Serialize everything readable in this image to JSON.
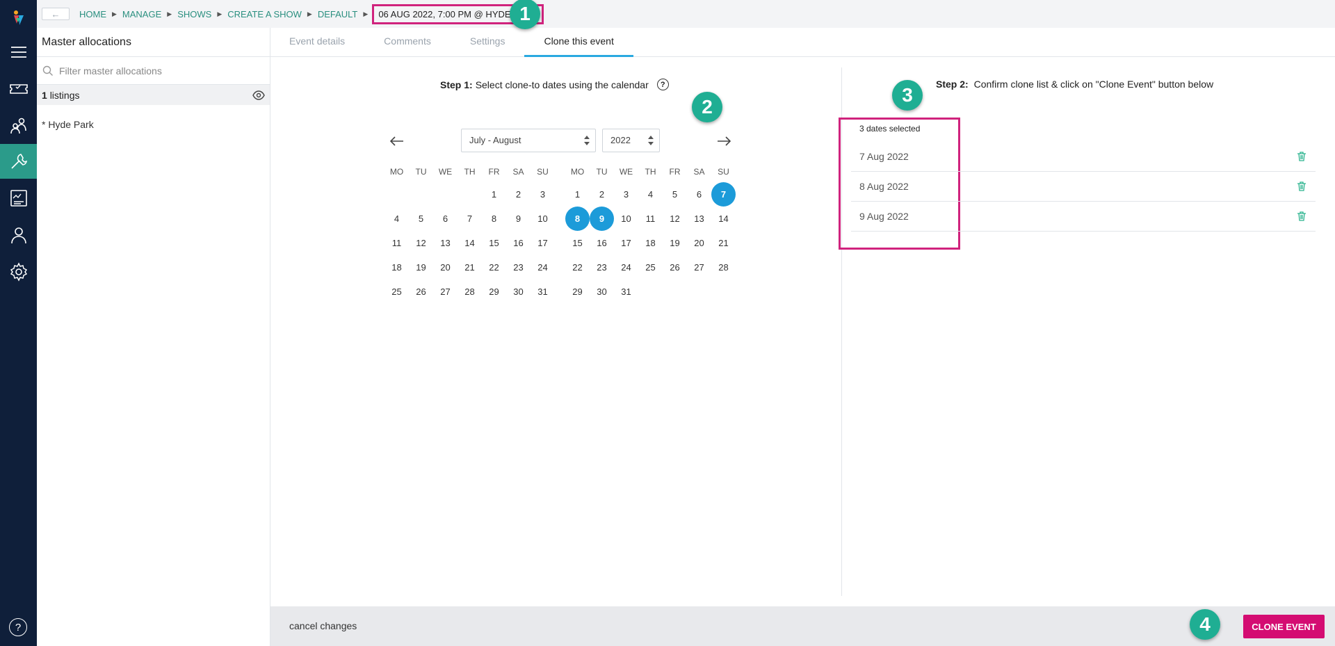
{
  "breadcrumb": {
    "back_label": "←",
    "items": [
      "HOME",
      "MANAGE",
      "SHOWS",
      "CREATE A SHOW",
      "DEFAULT"
    ],
    "current": "06 AUG 2022, 7:00 PM @ HYDE PARK"
  },
  "badges": [
    "1",
    "2",
    "3",
    "4"
  ],
  "sidebar": {
    "title": "Master allocations",
    "filter_placeholder": "Filter master allocations",
    "listings_count": "1",
    "listings_label": "listings",
    "items": [
      "* Hyde Park"
    ]
  },
  "tabs": [
    "Event details",
    "Comments",
    "Settings",
    "Clone this event"
  ],
  "active_tab": "Clone this event",
  "step1": {
    "label": "Step 1:",
    "text": "Select clone-to dates using the calendar",
    "help": "?"
  },
  "step2": {
    "label": "Step 2:",
    "text": "Confirm clone list & click on \"Clone Event\" button below"
  },
  "calendar": {
    "month_range": "July - August",
    "year": "2022",
    "weekdays": [
      "MO",
      "TU",
      "WE",
      "TH",
      "FR",
      "SA",
      "SU"
    ],
    "months": [
      {
        "name": "July",
        "first_weekday_index": 4,
        "days": 31,
        "selected": []
      },
      {
        "name": "August",
        "first_weekday_index": 0,
        "days": 31,
        "selected": [
          7,
          8,
          9
        ]
      }
    ]
  },
  "clone_list": {
    "count_label": "3 dates selected",
    "dates": [
      "7 Aug 2022",
      "8 Aug 2022",
      "9 Aug 2022"
    ]
  },
  "footer": {
    "cancel_label": "cancel changes",
    "clone_label": "CLONE EVENT"
  },
  "colors": {
    "accent_teal": "#2a8f7f",
    "badge": "#1fae93",
    "highlight": "#d0237d",
    "selected_day": "#1c9bd9",
    "primary_button": "#d40c72",
    "rail": "#0f1f3a"
  },
  "rail_icons": [
    "logo-icon",
    "menu-icon",
    "ticket-icon",
    "users-icon",
    "wrench-icon",
    "report-icon",
    "person-icon",
    "gear-icon",
    "help-icon"
  ]
}
